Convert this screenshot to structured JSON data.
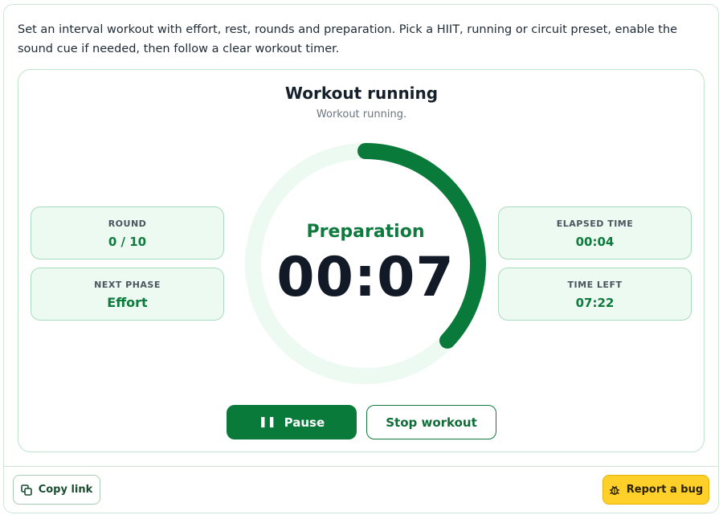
{
  "intro": "Set an interval workout with effort, rest, rounds and preparation. Pick a HIIT, running or circuit preset, enable the sound cue if needed, then follow a clear workout timer.",
  "status": {
    "title": "Workout running",
    "subtitle": "Workout running."
  },
  "stats": {
    "round": {
      "label": "ROUND",
      "value": "0 / 10"
    },
    "next_phase": {
      "label": "NEXT PHASE",
      "value": "Effort"
    },
    "elapsed": {
      "label": "ELAPSED TIME",
      "value": "00:04"
    },
    "time_left": {
      "label": "TIME LEFT",
      "value": "07:22"
    }
  },
  "timer": {
    "phase": "Preparation",
    "display": "00:07",
    "ring_progress": 0.37
  },
  "controls": {
    "pause_label": "Pause",
    "pause_icon": "pause-icon",
    "stop_label": "Stop workout"
  },
  "footer": {
    "copy_link_label": "Copy link",
    "copy_icon": "copy-icon",
    "report_bug_label": "Report a bug",
    "bug_icon": "bug-icon"
  },
  "colors": {
    "accent": "#0a7a3a",
    "ring_track": "#ecfaf1",
    "stat_bg": "#ecfaf1",
    "warning_button": "#ffd02a"
  }
}
